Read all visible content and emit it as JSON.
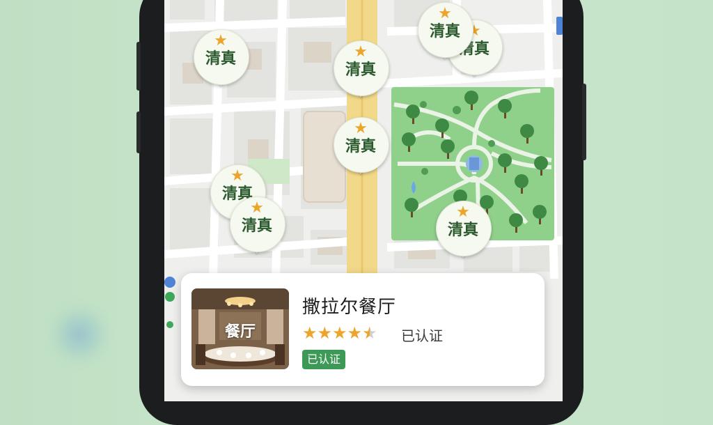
{
  "map": {
    "pins": [
      {
        "label": "清真",
        "icon": "star-icon"
      },
      {
        "label": "清真",
        "icon": "star-icon"
      },
      {
        "label": "清真",
        "icon": "star-icon"
      },
      {
        "label": "清真",
        "icon": "star-icon"
      },
      {
        "label": "清真",
        "icon": "star-icon"
      },
      {
        "label": "清真",
        "icon": "star-icon"
      },
      {
        "label": "清真",
        "icon": "star-icon"
      },
      {
        "label": "清真",
        "icon": "star-icon"
      }
    ],
    "colors": {
      "pin_text": "#2b5a2f",
      "pin_star": "#eca42a",
      "park": "#8fd08b",
      "main_road": "#f2d98a"
    }
  },
  "card": {
    "thumbnail_label": "餐厅",
    "title": "撒拉尔餐厅",
    "rating": 4.5,
    "verified_text": "已认证",
    "badge": "已认证",
    "badge_color": "#3d9a56"
  }
}
